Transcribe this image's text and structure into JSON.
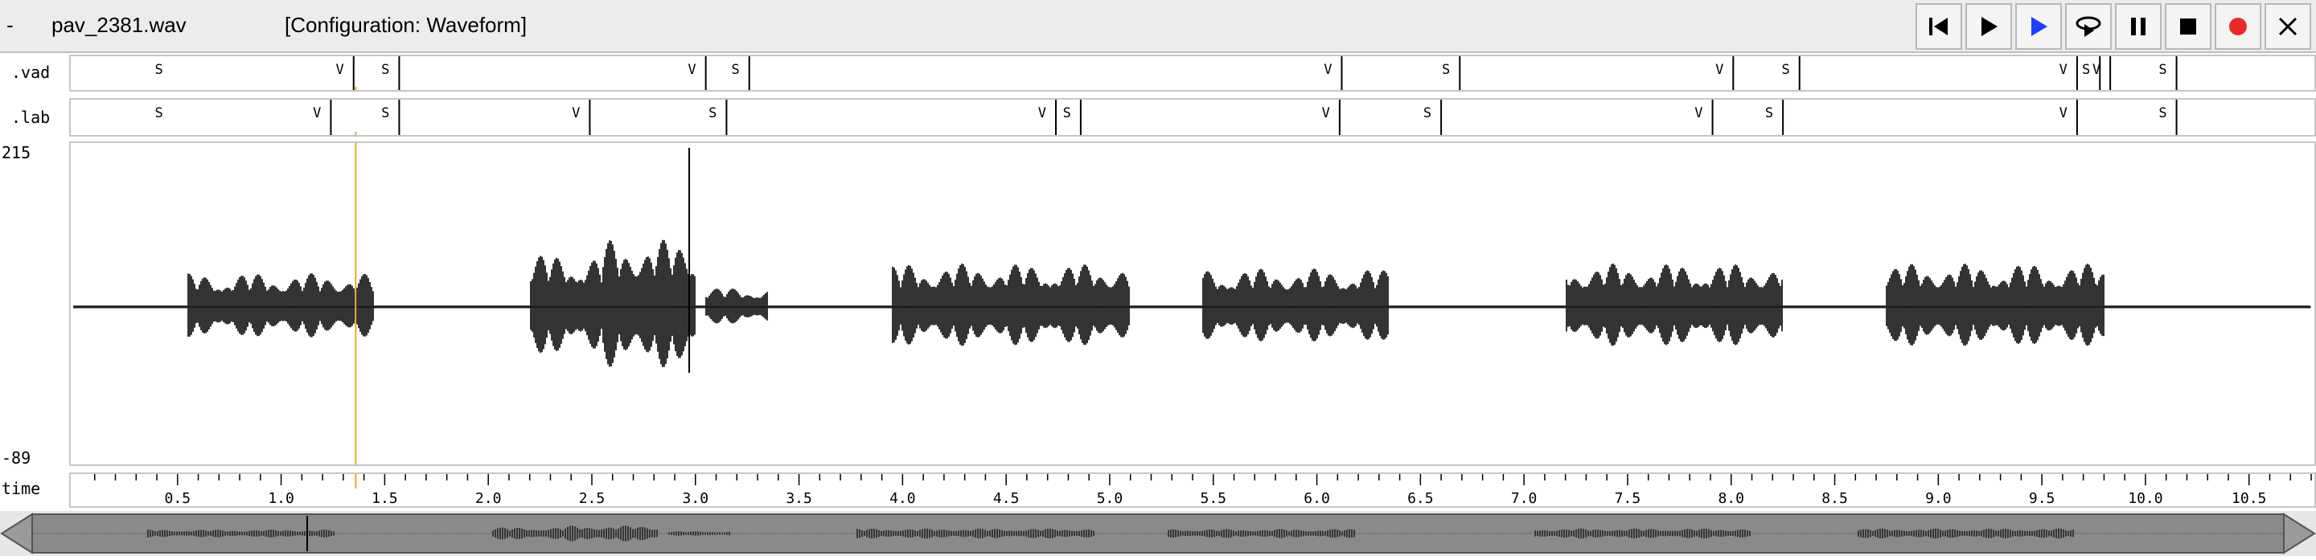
{
  "titlebar": {
    "menu_label": "-",
    "file_name": "pav_2381.wav",
    "configuration": "[Configuration: Waveform]"
  },
  "toolbar": [
    {
      "name": "skip-to-start-button",
      "icon": "skip-start-icon"
    },
    {
      "name": "play-button",
      "icon": "play-icon"
    },
    {
      "name": "play-selection-button",
      "icon": "play-blue-icon",
      "color": "#1f3fff"
    },
    {
      "name": "loop-play-button",
      "icon": "loop-play-icon"
    },
    {
      "name": "pause-button",
      "icon": "pause-icon"
    },
    {
      "name": "stop-button",
      "icon": "stop-icon"
    },
    {
      "name": "record-button",
      "icon": "record-icon",
      "color": "#ea2a2a"
    },
    {
      "name": "close-button",
      "icon": "close-icon"
    }
  ],
  "tiers": [
    {
      "label": ".vad",
      "marks": [
        {
          "t": 0.0,
          "s": "S"
        },
        {
          "t": 1.35,
          "s": "V"
        },
        {
          "t": 1.57,
          "s": "S"
        },
        {
          "t": 3.05,
          "s": "V"
        },
        {
          "t": 3.26,
          "s": "S"
        },
        {
          "t": 6.12,
          "s": "V"
        },
        {
          "t": 6.69,
          "s": "S"
        },
        {
          "t": 8.01,
          "s": "V"
        },
        {
          "t": 8.33,
          "s": "S"
        },
        {
          "t": 9.67,
          "s": "V"
        },
        {
          "t": 9.78,
          "s": "S"
        },
        {
          "t": 9.83,
          "s": "V"
        },
        {
          "t": 10.15,
          "s": "S"
        }
      ]
    },
    {
      "label": ".lab",
      "marks": [
        {
          "t": 0.0,
          "s": "S"
        },
        {
          "t": 1.24,
          "s": "V"
        },
        {
          "t": 1.57,
          "s": "S"
        },
        {
          "t": 2.49,
          "s": "V"
        },
        {
          "t": 3.15,
          "s": "S"
        },
        {
          "t": 4.74,
          "s": "V"
        },
        {
          "t": 4.86,
          "s": "S"
        },
        {
          "t": 6.11,
          "s": "V"
        },
        {
          "t": 6.6,
          "s": "S"
        },
        {
          "t": 7.91,
          "s": "V"
        },
        {
          "t": 8.25,
          "s": "S"
        },
        {
          "t": 9.67,
          "s": "V"
        },
        {
          "t": 10.15,
          "s": "S"
        }
      ]
    }
  ],
  "waveform": {
    "y_max_label": "215",
    "y_min_label": "-89",
    "cursor_time": 1.36,
    "cursor_color": "#f0a330",
    "view_start": 0.0,
    "view_end": 10.8
  },
  "time_axis": {
    "label": "time",
    "ticks": [
      "0.5",
      "1.0",
      "1.5",
      "2.0",
      "2.5",
      "3.0",
      "3.5",
      "4.0",
      "4.5",
      "5.0",
      "5.5",
      "6.0",
      "6.5",
      "7.0",
      "7.5",
      "8.0",
      "8.5",
      "9.0",
      "9.5",
      "10.0",
      "10.5"
    ]
  },
  "overview": {
    "left_arrow": "scroll-left-icon",
    "right_arrow": "scroll-right-icon"
  }
}
